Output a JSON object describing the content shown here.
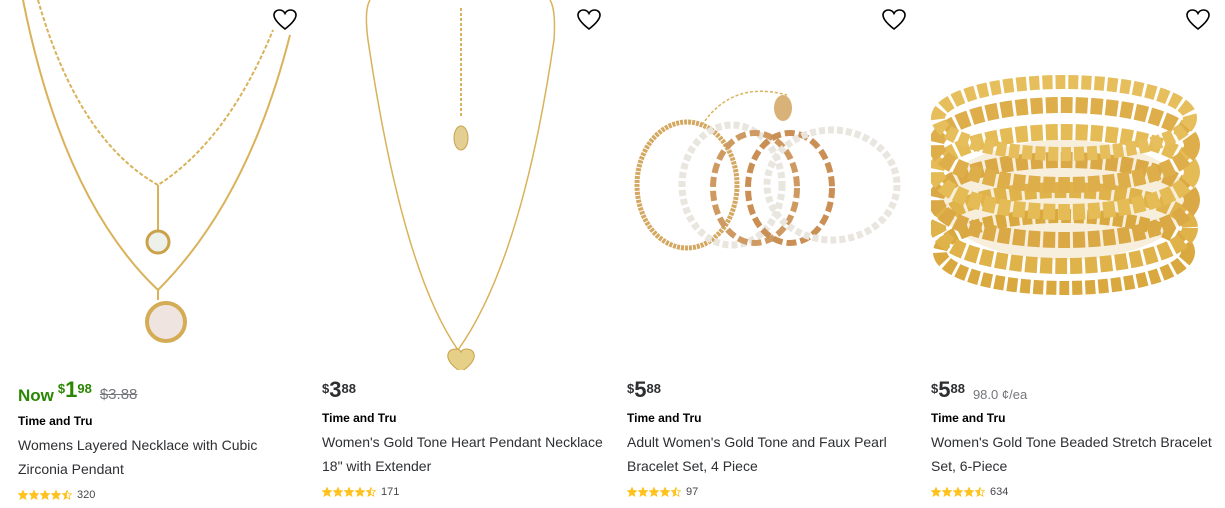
{
  "products": [
    {
      "now_label": "Now",
      "currency": "$",
      "dollars": "1",
      "cents": "98",
      "was_price": "$3.88",
      "unit_price": "",
      "brand": "Time and Tru",
      "title": "Womens Layered Necklace with Cubic Zirconia Pendant",
      "rating": 4.5,
      "review_count": "320",
      "price_color": "#2a8703"
    },
    {
      "now_label": "",
      "currency": "$",
      "dollars": "3",
      "cents": "88",
      "was_price": "",
      "unit_price": "",
      "brand": "Time and Tru",
      "title": "Women's Gold Tone Heart Pendant Necklace 18\" with Extender",
      "rating": 4.5,
      "review_count": "171",
      "price_color": "#000000"
    },
    {
      "now_label": "",
      "currency": "$",
      "dollars": "5",
      "cents": "88",
      "was_price": "",
      "unit_price": "",
      "brand": "Time and Tru",
      "title": "Adult Women's Gold Tone and Faux Pearl Bracelet Set, 4 Piece",
      "rating": 4.5,
      "review_count": "97",
      "price_color": "#000000"
    },
    {
      "now_label": "",
      "currency": "$",
      "dollars": "5",
      "cents": "88",
      "was_price": "",
      "unit_price": "98.0 ¢/ea",
      "brand": "Time and Tru",
      "title": "Women's Gold Tone Beaded Stretch Bracelet Set, 6-Piece",
      "rating": 4.5,
      "review_count": "634",
      "price_color": "#000000"
    }
  ],
  "colors": {
    "star": "#ffc220",
    "sale_green": "#2a8703",
    "gold": "#d9b25a"
  },
  "icons": {
    "favorite": "heart-outline-icon",
    "rating": "star-icon"
  }
}
